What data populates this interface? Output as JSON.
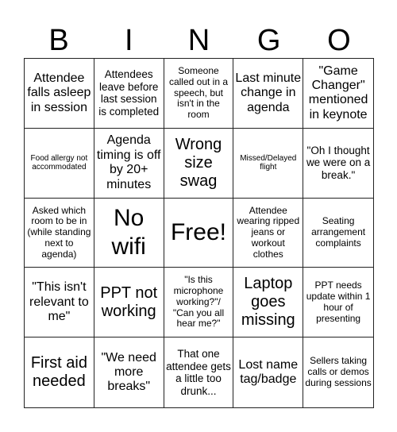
{
  "header": {
    "letters": [
      "B",
      "I",
      "N",
      "G",
      "O"
    ]
  },
  "cells": [
    {
      "text": "Attendee falls asleep in session",
      "size": "s-lg"
    },
    {
      "text": "Attendees leave before last session is completed",
      "size": "s-md"
    },
    {
      "text": "Someone called out in a speech, but isn't in the room",
      "size": "s-sm"
    },
    {
      "text": "Last minute change in agenda",
      "size": "s-lg"
    },
    {
      "text": "\"Game Changer\" mentioned in keynote",
      "size": "s-lg"
    },
    {
      "text": "Food allergy not accommodated",
      "size": "s-xs"
    },
    {
      "text": "Agenda timing is off by 20+ minutes",
      "size": "s-lg"
    },
    {
      "text": "Wrong size swag",
      "size": "s-xl"
    },
    {
      "text": "Missed/Delayed flight",
      "size": "s-xs"
    },
    {
      "text": "\"Oh I thought we were on a break.\"",
      "size": "s-md"
    },
    {
      "text": "Asked which room to be in (while standing next to agenda)",
      "size": "s-sm"
    },
    {
      "text": "No wifi",
      "size": "s-xxl"
    },
    {
      "text": "Free!",
      "size": "s-xxl",
      "free": true
    },
    {
      "text": "Attendee wearing ripped jeans or workout clothes",
      "size": "s-sm"
    },
    {
      "text": "Seating arrangement complaints",
      "size": "s-sm"
    },
    {
      "text": "\"This isn't relevant to me\"",
      "size": "s-lg"
    },
    {
      "text": "PPT not working",
      "size": "s-xl"
    },
    {
      "text": "\"Is this microphone working?\"/ \"Can you all hear me?\"",
      "size": "s-sm"
    },
    {
      "text": "Laptop goes missing",
      "size": "s-xl"
    },
    {
      "text": "PPT needs update within 1 hour of presenting",
      "size": "s-sm"
    },
    {
      "text": "First aid needed",
      "size": "s-xl"
    },
    {
      "text": "\"We need more breaks\"",
      "size": "s-lg"
    },
    {
      "text": "That one attendee gets a little too drunk...",
      "size": "s-md"
    },
    {
      "text": "Lost name tag/badge",
      "size": "s-lg"
    },
    {
      "text": "Sellers taking calls or demos during sessions",
      "size": "s-sm"
    }
  ]
}
